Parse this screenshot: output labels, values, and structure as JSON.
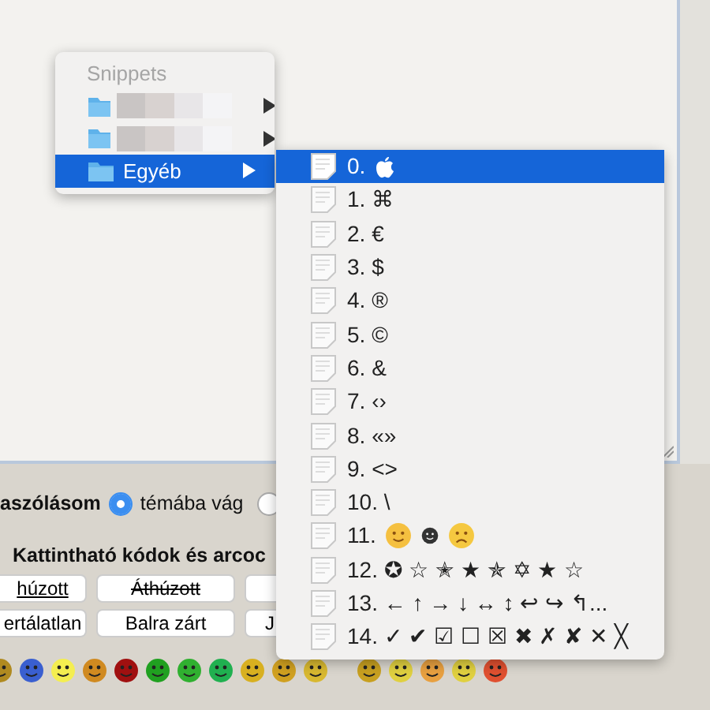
{
  "radio_row": {
    "label": "aszólásom",
    "options": [
      {
        "label": "témába vág",
        "selected": true
      },
      {
        "selected": false
      }
    ]
  },
  "codes_heading": "Kattintható kódok és arcoc",
  "code_buttons": [
    [
      {
        "label": "húzott",
        "kind": "underlined"
      },
      {
        "label": "Áthúzott",
        "kind": "struck"
      },
      {
        "kind": "blank"
      }
    ],
    [
      {
        "label": "ertálatlan",
        "kind": "plain"
      },
      {
        "label": "Balra zárt",
        "kind": "plain"
      },
      {
        "label": "J",
        "kind": "plain"
      }
    ]
  ],
  "smileys": [
    {
      "color": "#b08a20"
    },
    {
      "color": "#3a5fd0"
    },
    {
      "color": "#f4ee50"
    },
    {
      "color": "#d08a20"
    },
    {
      "color": "#a01010"
    },
    {
      "color": "#20a020"
    },
    {
      "color": "#30b030"
    },
    {
      "color": "#20b050"
    },
    {
      "color": "#d8b020"
    },
    {
      "color": "#d0a020"
    },
    {
      "color": "#d8b830"
    },
    {
      "color": "#c8a020"
    },
    {
      "color": "#e0d040"
    },
    {
      "color": "#e8a040"
    },
    {
      "color": "#e0d040"
    },
    {
      "color": "#e05030"
    }
  ],
  "menu": {
    "header": "Snippets",
    "items": [
      {
        "blurred": true,
        "selected": false
      },
      {
        "blurred": true,
        "selected": false
      },
      {
        "label": "Egyéb",
        "selected": true
      }
    ]
  },
  "submenu": {
    "items": [
      {
        "label": "0.",
        "kind": "apple",
        "selected": true
      },
      {
        "label": "1. ⌘",
        "kind": "text",
        "selected": false
      },
      {
        "label": "2. €",
        "kind": "text",
        "selected": false
      },
      {
        "label": "3. $",
        "kind": "text",
        "selected": false
      },
      {
        "label": "4. ®",
        "kind": "text",
        "selected": false
      },
      {
        "label": "5. ©",
        "kind": "text",
        "selected": false
      },
      {
        "label": "6. &",
        "kind": "text",
        "selected": false
      },
      {
        "label": "7. ‹›",
        "kind": "text",
        "selected": false
      },
      {
        "label": "8. «»",
        "kind": "text",
        "selected": false
      },
      {
        "label": "9. <>",
        "kind": "text",
        "selected": false
      },
      {
        "label": "10. \\",
        "kind": "text",
        "selected": false
      },
      {
        "label": "11.",
        "kind": "smileys",
        "selected": false
      },
      {
        "label": "12. ✪ ☆ ✭ ★ ✯ ✡ ★ ☆",
        "kind": "text",
        "selected": false
      },
      {
        "label": "13. ← ↑ → ↓ ↔ ↕ ↩ ↪ ↰...",
        "kind": "text",
        "selected": false
      },
      {
        "label": "14. ✓ ✔ ☑ ☐ ☒ ✖ ✗ ✘ ✕ ╳",
        "kind": "text",
        "selected": false
      }
    ]
  }
}
